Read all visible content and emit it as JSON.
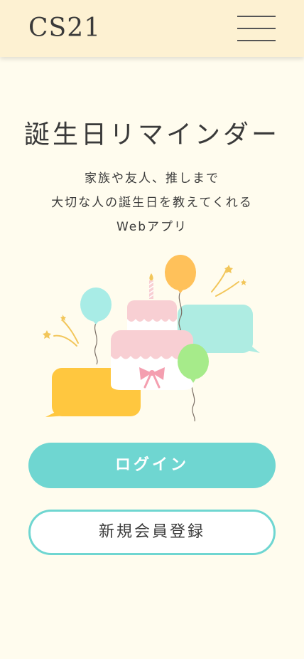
{
  "header": {
    "logo": "CS21",
    "menu_icon": "hamburger-menu-icon"
  },
  "hero": {
    "title": "誕生日リマインダー",
    "subtitle_lines": [
      "家族や友人、推しまで",
      "大切な人の誕生日を教えてくれる",
      "Webアプリ"
    ]
  },
  "illustration": {
    "icon": "birthday-cake-balloons-illustration",
    "colors": {
      "cake_pink": "#f8cfd3",
      "balloon_orange": "#ffc15a",
      "balloon_mint": "#a8ece6",
      "balloon_green": "#a6eb8a",
      "bubble_yellow": "#ffc73f",
      "bubble_mint": "#aeece2",
      "star_gold": "#f2c65a"
    }
  },
  "actions": {
    "login_label": "ログイン",
    "register_label": "新規会員登録"
  },
  "colors": {
    "background": "#fffcee",
    "header_bg": "#fdf1d2",
    "accent": "#6fd6d1"
  }
}
